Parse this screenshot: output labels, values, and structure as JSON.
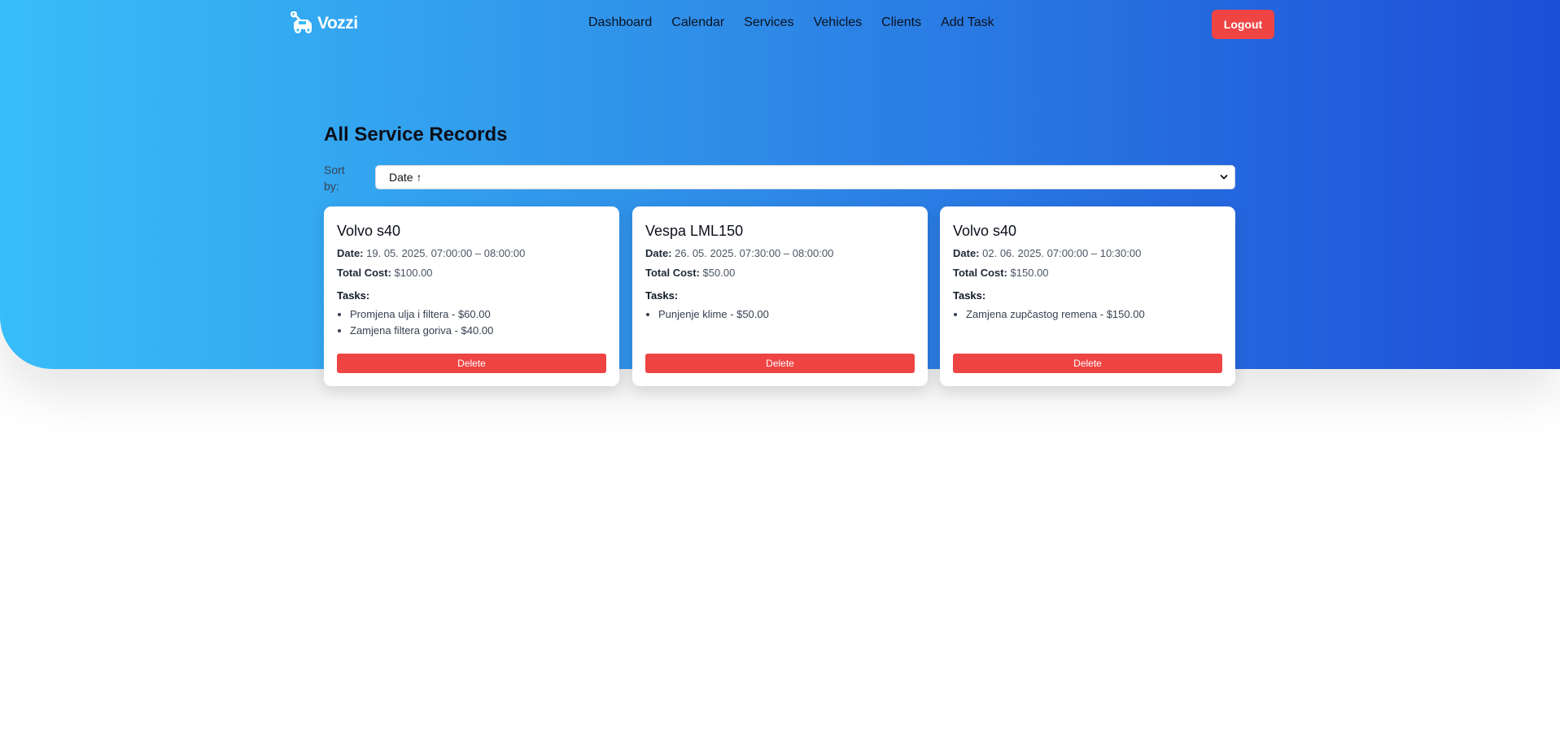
{
  "brand": {
    "name": "Vozzi",
    "icon": "car-wrench-icon"
  },
  "nav": {
    "links": [
      "Dashboard",
      "Calendar",
      "Services",
      "Vehicles",
      "Clients",
      "Add Task"
    ],
    "logout_label": "Logout"
  },
  "colors": {
    "gradient_start": "#38bdf8",
    "gradient_end": "#1d4ed8",
    "danger": "#ef4444"
  },
  "page": {
    "title": "All Service Records",
    "sort_label": "Sort by:",
    "sort_value": "Date ↑"
  },
  "labels": {
    "date": "Date:",
    "total_cost": "Total Cost:",
    "tasks": "Tasks:",
    "delete": "Delete"
  },
  "records": [
    {
      "vehicle": "Volvo s40",
      "date": "19. 05. 2025. 07:00:00 – 08:00:00",
      "total_cost": "$100.00",
      "tasks": [
        "Promjena ulja i filtera - $60.00",
        "Zamjena filtera goriva - $40.00"
      ]
    },
    {
      "vehicle": "Vespa LML150",
      "date": "26. 05. 2025. 07:30:00 – 08:00:00",
      "total_cost": "$50.00",
      "tasks": [
        "Punjenje klime - $50.00"
      ]
    },
    {
      "vehicle": "Volvo s40",
      "date": "02. 06. 2025. 07:00:00 – 10:30:00",
      "total_cost": "$150.00",
      "tasks": [
        "Zamjena zupčastog remena - $150.00"
      ]
    }
  ]
}
